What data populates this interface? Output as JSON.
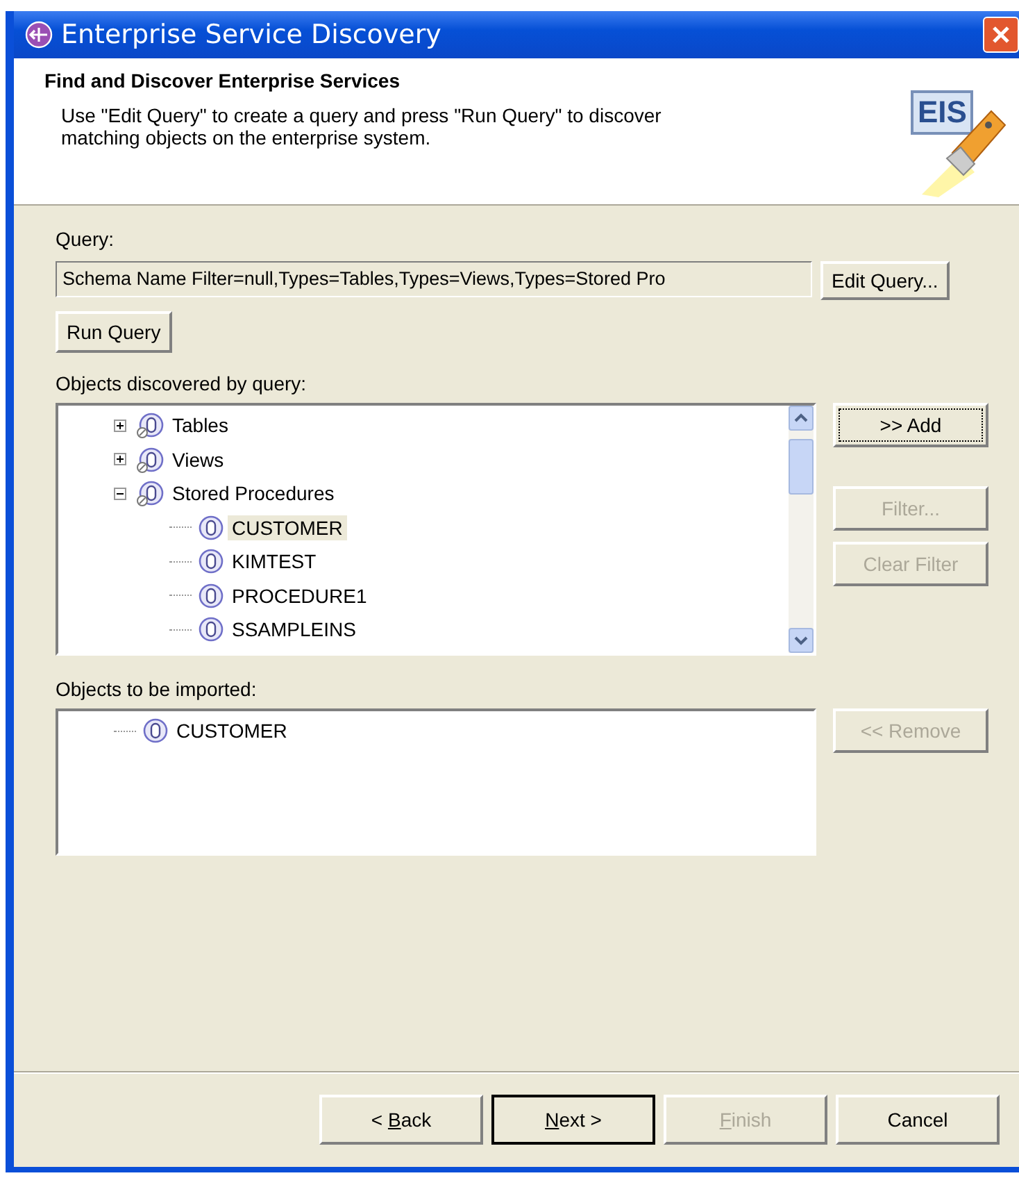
{
  "window": {
    "title": "Enterprise Service Discovery"
  },
  "header": {
    "title": "Find and Discover Enterprise Services",
    "description": "Use \"Edit Query\" to create a query and press \"Run Query\" to discover matching objects on the enterprise system.",
    "logo_text": "EIS"
  },
  "query": {
    "label": "Query:",
    "value": "Schema Name Filter=null,Types=Tables,Types=Views,Types=Stored Pro",
    "edit_button": {
      "label": "Edit Query...",
      "disabled": false
    },
    "run_button": {
      "label": "Run Query",
      "disabled": false
    }
  },
  "discovered": {
    "label": "Objects discovered by query:",
    "items": [
      {
        "label": "Tables",
        "kind": "folder",
        "expanded": false,
        "selected": false
      },
      {
        "label": "Views",
        "kind": "folder",
        "expanded": false,
        "selected": false
      },
      {
        "label": "Stored Procedures",
        "kind": "folder",
        "expanded": true,
        "selected": false,
        "children": [
          {
            "label": "CUSTOMER",
            "kind": "object",
            "selected": true
          },
          {
            "label": "KIMTEST",
            "kind": "object",
            "selected": false
          },
          {
            "label": "PROCEDURE1",
            "kind": "object",
            "selected": false
          },
          {
            "label": "SSAMPLEINS",
            "kind": "object",
            "selected": false
          }
        ]
      }
    ],
    "buttons": [
      {
        "label": ">> Add",
        "disabled": false,
        "focused": true
      },
      {
        "label": "Filter...",
        "disabled": true,
        "focused": false
      },
      {
        "label": "Clear Filter",
        "disabled": true,
        "focused": false
      }
    ]
  },
  "imported": {
    "label": "Objects to be imported:",
    "items": [
      {
        "label": "CUSTOMER",
        "kind": "object",
        "selected": false
      }
    ],
    "buttons": [
      {
        "label": "<< Remove",
        "disabled": true,
        "focused": false
      }
    ]
  },
  "footer_buttons": [
    {
      "before": "< ",
      "mnemonic": "B",
      "after": "ack",
      "disabled": false,
      "default": false
    },
    {
      "mnemonic": "N",
      "after": "ext >",
      "disabled": false,
      "default": true
    },
    {
      "mnemonic": "F",
      "after": "inish",
      "disabled": true,
      "default": false
    },
    {
      "label": "Cancel",
      "disabled": false,
      "default": false
    }
  ]
}
